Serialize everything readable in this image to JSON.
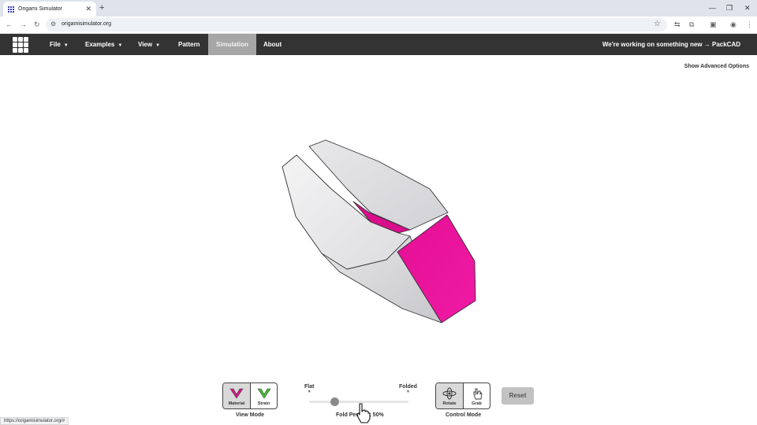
{
  "browser": {
    "tab_title": "Origami Simulator",
    "new_tab_icon": "+",
    "url": "origamisimulator.org",
    "status_url": "https://origamisimulator.org/#"
  },
  "navbar": {
    "file": "File",
    "examples": "Examples",
    "view": "View",
    "pattern": "Pattern",
    "simulation": "Simulation",
    "about": "About",
    "news": "We're working on something new → PackCAD"
  },
  "advanced_options": "Show Advanced Options",
  "view_mode": {
    "material": "Material",
    "strain": "Strain",
    "label": "View Mode",
    "selected": "Material"
  },
  "fold_slider": {
    "min_label": "Flat",
    "max_label": "Folded",
    "label": "Fold Percent: 50%",
    "percent": 50
  },
  "control_mode": {
    "rotate": "Rotate",
    "grab": "Grab",
    "label": "Control Mode",
    "selected": "Rotate"
  },
  "reset_label": "Reset",
  "colors": {
    "navbar_bg": "#333333",
    "active_tab_bg": "#a6a6a6",
    "paper_front": "#e4e4e6",
    "paper_back": "#ec1aa0"
  }
}
